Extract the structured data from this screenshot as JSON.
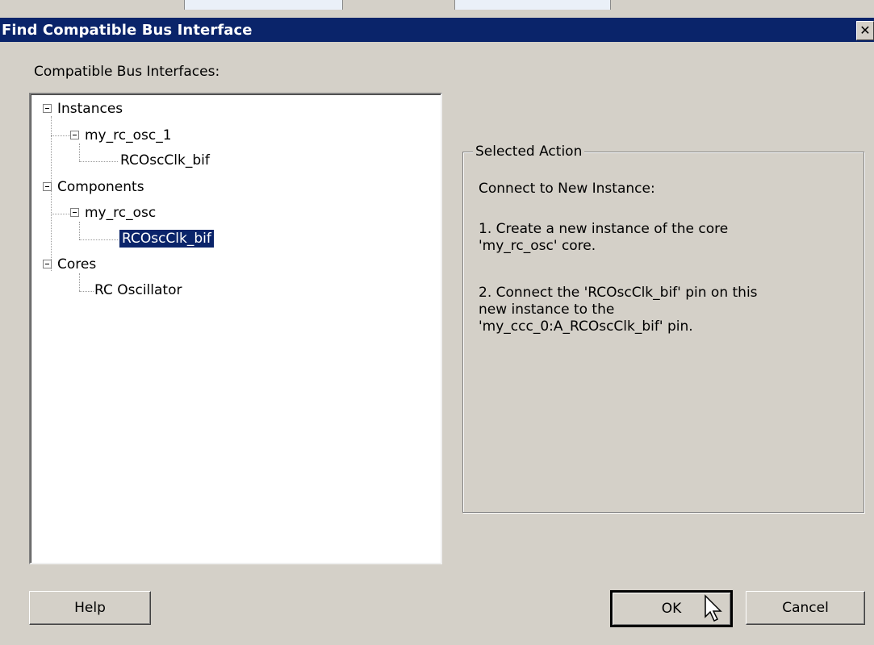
{
  "window": {
    "title": "Find Compatible Bus Interface",
    "close_glyph": "✕"
  },
  "tree": {
    "label": "Compatible Bus Interfaces:",
    "instances": "Instances",
    "instance_1": "my_rc_osc_1",
    "instance_1_child": "RCOscClk_bif",
    "components": "Components",
    "component_1": "my_rc_osc",
    "component_1_child": "RCOscClk_bif",
    "cores": "Cores",
    "core_1": "RC Oscillator"
  },
  "action": {
    "legend": "Selected Action",
    "heading": "Connect to New Instance:",
    "step1_line1": "1. Create a new instance of the core",
    "step1_line2": "'my_rc_osc' core.",
    "step2_line1": "2. Connect the 'RCOscClk_bif'  pin on this",
    "step2_line2": "new instance to the",
    "step2_line3": "'my_ccc_0:A_RCOscClk_bif'  pin."
  },
  "buttons": {
    "help": "Help",
    "ok": "OK",
    "cancel": "Cancel"
  },
  "icons": {
    "close": "close-icon",
    "expander": "minus-box-icon",
    "cursor": "mouse-pointer-icon"
  },
  "colors": {
    "titlebar": "#0a246a",
    "face": "#d4d0c8",
    "selection": "#0a246a"
  }
}
